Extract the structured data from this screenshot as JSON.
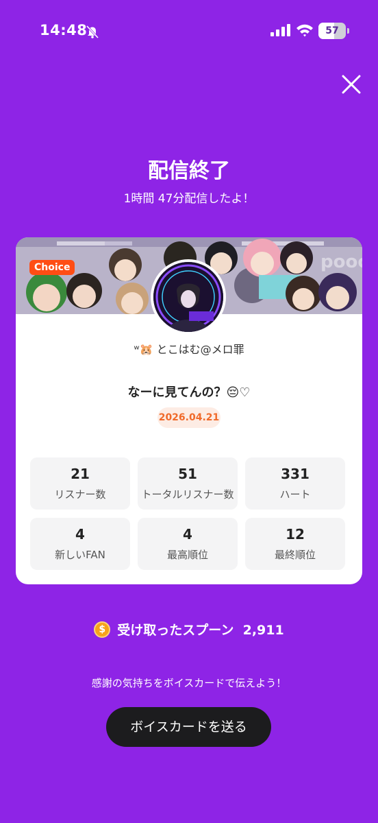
{
  "status_bar": {
    "time": "14:48",
    "battery": "57",
    "battery_level": 0.57,
    "icons": [
      "bell-slash-icon",
      "signal-icon",
      "wifi-icon",
      "battery-icon"
    ]
  },
  "header": {
    "close_icon": "close-icon",
    "title": "配信終了",
    "subtitle": "1時間 47分配信したよ！"
  },
  "card": {
    "badge": "Choice",
    "username": "ʷ🐹 とこはむ@メロ罪",
    "stream_title": "なーに見てんの？😔♡",
    "date": "2026.04.21",
    "stats": [
      {
        "value": "21",
        "label": "リスナー数"
      },
      {
        "value": "51",
        "label": "トータルリスナー数"
      },
      {
        "value": "331",
        "label": "ハート"
      },
      {
        "value": "4",
        "label": "新しいFAN"
      },
      {
        "value": "4",
        "label": "最高順位"
      },
      {
        "value": "12",
        "label": "最終順位"
      }
    ]
  },
  "spoons": {
    "label": "受け取ったスプーン",
    "value": "2,911"
  },
  "footer": {
    "thanks_text": "感謝の気持ちをボイスカードで伝えよう！",
    "button_label": "ボイスカードを送る"
  },
  "colors": {
    "background": "#8e24e6",
    "badge": "#ff4d14",
    "date_text": "#f06a2a",
    "button": "#1c1c1e"
  }
}
